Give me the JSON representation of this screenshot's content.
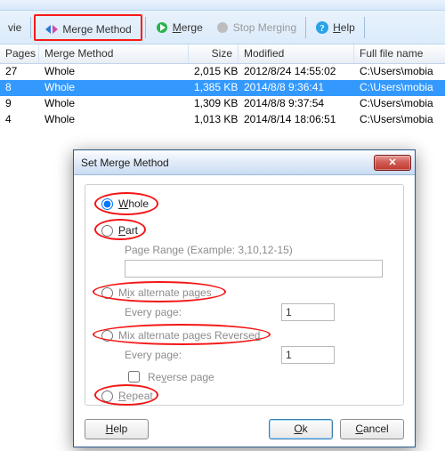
{
  "toolbar": {
    "view_fragment": "vie",
    "merge_method": "Merge Method",
    "merge": "Merge",
    "stop_merging": "Stop Merging",
    "help": "Help"
  },
  "columns": {
    "pages": "Pages",
    "method": "Merge Method",
    "size": "Size",
    "modified": "Modified",
    "full": "Full file name"
  },
  "rows": [
    {
      "pages": "27",
      "method": "Whole",
      "size": "2,015 KB",
      "modified": "2012/8/24 14:55:02",
      "full": "C:\\Users\\mobia"
    },
    {
      "pages": "8",
      "method": "Whole",
      "size": "1,385 KB",
      "modified": "2014/8/8 9:36:41",
      "full": "C:\\Users\\mobia"
    },
    {
      "pages": "9",
      "method": "Whole",
      "size": "1,309 KB",
      "modified": "2014/8/8 9:37:54",
      "full": "C:\\Users\\mobia"
    },
    {
      "pages": "4",
      "method": "Whole",
      "size": "1,013 KB",
      "modified": "2014/8/14 18:06:51",
      "full": "C:\\Users\\mobia"
    }
  ],
  "selected_index": 1,
  "dialog": {
    "title": "Set Merge Method",
    "whole_html": "<span class='u'>W</span>hole",
    "part_html": "<span class='u'>P</span>art",
    "range_hint": "Page Range (Example: 3,10,12-15)",
    "range_value": "",
    "mix_html": "M<span class='u'>i</span>x alternate pages",
    "mix_rev_html": "Mix alternate pages Reverse<span class='u'>d</span>",
    "every_page": "Every page:",
    "every_val1": "1",
    "every_val2": "1",
    "reverse_html": "Re<span class='u'>v</span>erse page",
    "repeat_html": "<span class='u'>R</span>epeat",
    "help": "Help",
    "ok_html": "<span class='u'>O</span>k",
    "cancel": "Cancel"
  }
}
